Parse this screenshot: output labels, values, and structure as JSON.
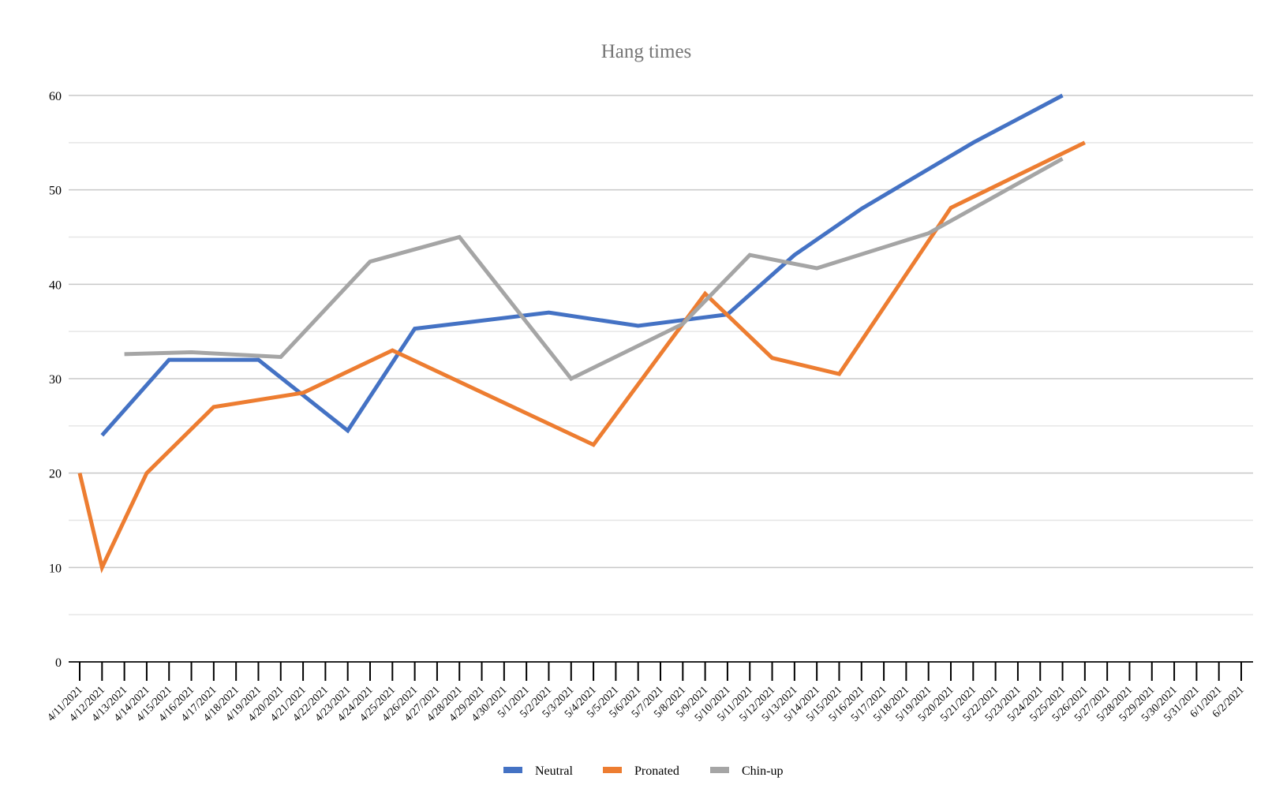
{
  "chart_data": {
    "type": "line",
    "title": "Hang times",
    "xlabel": "",
    "ylabel": "",
    "ylim": [
      0,
      60
    ],
    "yticks": [
      0,
      10,
      20,
      30,
      40,
      50,
      60
    ],
    "minor_gridlines": true,
    "legend": "bottom",
    "categories": [
      "4/11/2021",
      "4/12/2021",
      "4/13/2021",
      "4/14/2021",
      "4/15/2021",
      "4/16/2021",
      "4/17/2021",
      "4/18/2021",
      "4/19/2021",
      "4/20/2021",
      "4/21/2021",
      "4/22/2021",
      "4/23/2021",
      "4/24/2021",
      "4/25/2021",
      "4/26/2021",
      "4/27/2021",
      "4/28/2021",
      "4/29/2021",
      "4/30/2021",
      "5/1/2021",
      "5/2/2021",
      "5/3/2021",
      "5/4/2021",
      "5/5/2021",
      "5/6/2021",
      "5/7/2021",
      "5/8/2021",
      "5/9/2021",
      "5/10/2021",
      "5/11/2021",
      "5/12/2021",
      "5/13/2021",
      "5/14/2021",
      "5/15/2021",
      "5/16/2021",
      "5/17/2021",
      "5/18/2021",
      "5/19/2021",
      "5/20/2021",
      "5/21/2021",
      "5/22/2021",
      "5/23/2021",
      "5/24/2021",
      "5/25/2021",
      "5/26/2021",
      "5/27/2021",
      "5/28/2021",
      "5/29/2021",
      "5/30/2021",
      "5/31/2021",
      "6/1/2021",
      "6/2/2021"
    ],
    "series": [
      {
        "name": "Neutral",
        "color": "#4472c4",
        "points": [
          [
            "4/12/2021",
            24
          ],
          [
            "4/15/2021",
            32
          ],
          [
            "4/19/2021",
            32
          ],
          [
            "4/23/2021",
            24.5
          ],
          [
            "4/26/2021",
            35.3
          ],
          [
            "5/2/2021",
            37
          ],
          [
            "5/6/2021",
            35.6
          ],
          [
            "5/10/2021",
            36.8
          ],
          [
            "5/13/2021",
            43.1
          ],
          [
            "5/16/2021",
            48
          ],
          [
            "5/21/2021",
            55
          ],
          [
            "5/25/2021",
            60
          ]
        ]
      },
      {
        "name": "Pronated",
        "color": "#ed7d31",
        "points": [
          [
            "4/11/2021",
            20
          ],
          [
            "4/12/2021",
            10
          ],
          [
            "4/14/2021",
            20
          ],
          [
            "4/17/2021",
            27
          ],
          [
            "4/21/2021",
            28.5
          ],
          [
            "4/25/2021",
            33
          ],
          [
            "5/4/2021",
            23
          ],
          [
            "5/9/2021",
            39
          ],
          [
            "5/12/2021",
            32.2
          ],
          [
            "5/15/2021",
            30.5
          ],
          [
            "5/20/2021",
            48.1
          ],
          [
            "5/26/2021",
            55
          ]
        ]
      },
      {
        "name": "Chin-up",
        "color": "#a5a5a5",
        "points": [
          [
            "4/13/2021",
            32.6
          ],
          [
            "4/16/2021",
            32.8
          ],
          [
            "4/20/2021",
            32.3
          ],
          [
            "4/24/2021",
            42.4
          ],
          [
            "4/28/2021",
            45
          ],
          [
            "5/3/2021",
            30
          ],
          [
            "5/8/2021",
            35.8
          ],
          [
            "5/11/2021",
            43.1
          ],
          [
            "5/14/2021",
            41.7
          ],
          [
            "5/19/2021",
            45.4
          ],
          [
            "5/25/2021",
            53.3
          ]
        ]
      }
    ]
  }
}
